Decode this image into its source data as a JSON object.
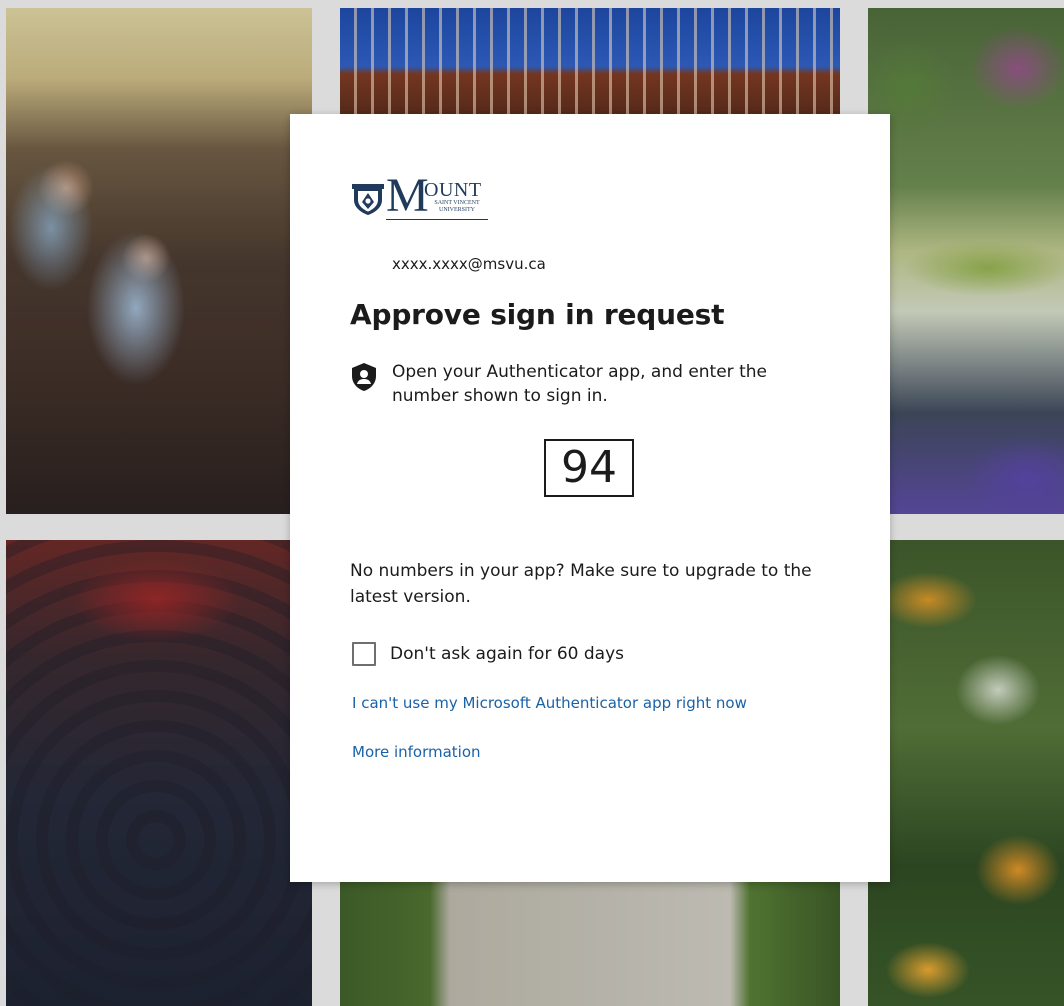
{
  "brand": {
    "logo_letter": "M",
    "logo_rest": "OUNT",
    "logo_sub_line1": "SAINT VINCENT",
    "logo_sub_line2": "UNIVERSITY"
  },
  "signin": {
    "email": "xxxx.xxxx@msvu.ca",
    "title": "Approve sign in request",
    "instruction": "Open your Authenticator app, and enter the number shown to sign in.",
    "number": "94",
    "no_numbers_note": "No numbers in your app? Make sure to upgrade to the latest version.",
    "remember_label": "Don't ask again for 60 days",
    "remember_checked": false,
    "cant_use_link": "I can't use my Microsoft Authenticator app right now",
    "more_info_link": "More information"
  },
  "icons": {
    "authenticator": "authenticator-lock-icon",
    "logo_shield": "university-shield-icon"
  },
  "colors": {
    "link": "#1a62a8",
    "text": "#1b1b1b",
    "brand_navy": "#1f3a5a"
  }
}
